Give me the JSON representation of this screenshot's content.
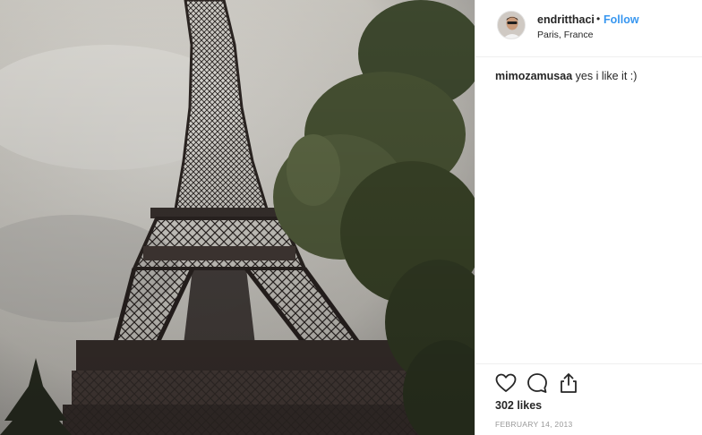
{
  "photo": {
    "subject": "eiffel-tower"
  },
  "header": {
    "username": "endritthaci",
    "separator": "•",
    "follow_label": "Follow",
    "location": "Paris, France"
  },
  "comment": {
    "username": "mimozamusaa",
    "text": "yes i like it :)"
  },
  "actions": {
    "likes": "302 likes",
    "date": "FEBRUARY 14, 2013"
  },
  "colors": {
    "link": "#3897f0",
    "border": "#efefef",
    "muted": "#999999"
  }
}
